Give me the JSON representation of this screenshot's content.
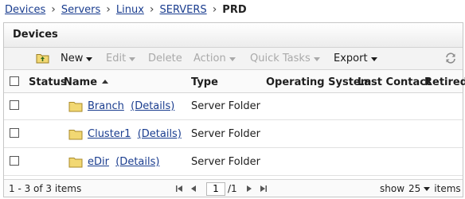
{
  "breadcrumb": {
    "items": [
      "Devices",
      "Servers",
      "Linux",
      "SERVERS"
    ],
    "current": "PRD"
  },
  "panel": {
    "title": "Devices"
  },
  "toolbar": {
    "new_label": "New",
    "edit_label": "Edit",
    "delete_label": "Delete",
    "action_label": "Action",
    "quick_tasks_label": "Quick Tasks",
    "export_label": "Export"
  },
  "grid": {
    "columns": {
      "status": "Status",
      "name": "Name",
      "type": "Type",
      "os": "Operating System",
      "last_contact": "Last Contact",
      "retired": "Retired"
    },
    "rows": [
      {
        "name": "Branch",
        "details": "(Details)",
        "type": "Server Folder"
      },
      {
        "name": "Cluster1",
        "details": "(Details)",
        "type": "Server Folder"
      },
      {
        "name": "eDir",
        "details": "(Details)",
        "type": "Server Folder"
      }
    ]
  },
  "footer": {
    "count_text": "1 - 3 of 3 items",
    "page_value": "1",
    "page_total": "/1",
    "show_label": "show",
    "page_size": "25",
    "items_label": "items"
  },
  "colors": {
    "link": "#1a3d8f",
    "folder": "#f2d873",
    "disabled_text": "#a9a9a9"
  }
}
